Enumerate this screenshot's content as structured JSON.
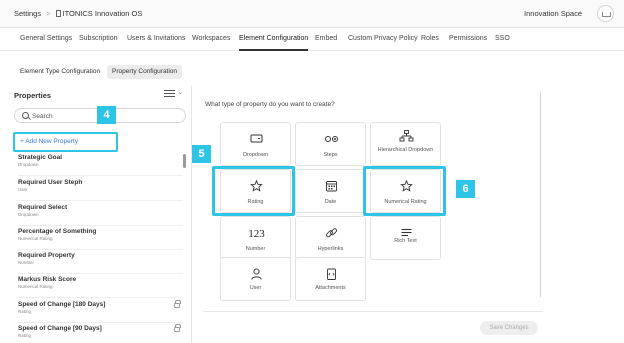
{
  "breadcrumb": {
    "root": "Settings",
    "separator": ">",
    "page": "ITONICS Innovation OS"
  },
  "workspace": {
    "label": "Innovation Space"
  },
  "nav_tabs": [
    "General Settings",
    "Subscription",
    "Users & Invitations",
    "Workspaces",
    "Element Configuration",
    "Embed",
    "Custom Privacy Policy",
    "Roles",
    "Permissions",
    "SSO"
  ],
  "active_nav_tab": "Element Configuration",
  "sub_tabs": [
    "Element Type Configuration",
    "Property Configuration"
  ],
  "active_sub_tab": "Property Configuration",
  "properties": {
    "title": "Properties",
    "search_placeholder": "Search",
    "add_label": "+ Add New Property",
    "items": [
      {
        "name": "Strategic Goal",
        "type": "Dropdown",
        "locked": false
      },
      {
        "name": "Required User Steph",
        "type": "User",
        "locked": false
      },
      {
        "name": "Required Select",
        "type": "Dropdown",
        "locked": false
      },
      {
        "name": "Percentage of Something",
        "type": "Numerical Rating",
        "locked": false
      },
      {
        "name": "Required Property",
        "type": "Number",
        "locked": false
      },
      {
        "name": "Markus Risk Score",
        "type": "Numerical Rating",
        "locked": false
      },
      {
        "name": "Speed of Change [180 Days]",
        "type": "Rating",
        "locked": true
      },
      {
        "name": "Speed of Change [90 Days]",
        "type": "Rating",
        "locked": true
      }
    ]
  },
  "main": {
    "question": "What type of property do you want to create?",
    "types": [
      {
        "label": "Dropdown",
        "icon": "dropdown-icon"
      },
      {
        "label": "Steps",
        "icon": "steps-icon"
      },
      {
        "label": "Hierarchical Dropdown",
        "icon": "hierarchy-icon"
      },
      {
        "label": "Rating",
        "icon": "star-icon"
      },
      {
        "label": "Date",
        "icon": "calendar-icon"
      },
      {
        "label": "Numerical Rating",
        "icon": "star-icon"
      },
      {
        "label": "Number",
        "icon": "number-icon"
      },
      {
        "label": "Hyperlinks",
        "icon": "link-icon"
      },
      {
        "label": "Rich Text",
        "icon": "text-icon"
      },
      {
        "label": "User",
        "icon": "user-icon"
      },
      {
        "label": "Attachments",
        "icon": "attachment-icon"
      }
    ],
    "save_label": "Save Changes"
  },
  "markers": [
    "4",
    "5",
    "6"
  ],
  "colors": {
    "highlight": "#2ec4e6",
    "link": "#3a7bd5",
    "text": "#333333"
  }
}
